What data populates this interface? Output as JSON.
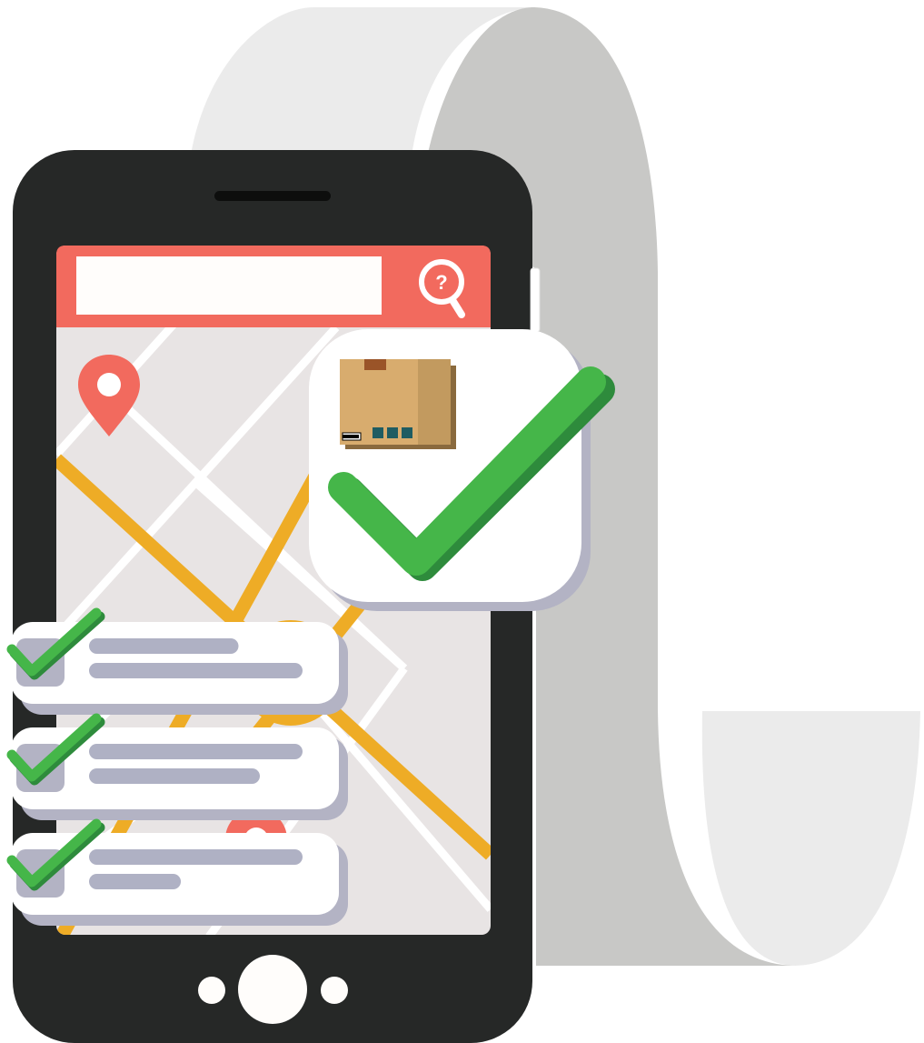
{
  "colors": {
    "background": "#ffffff",
    "scroll_light": "#ebebeb",
    "scroll_dark": "#c8c8c6",
    "phone_body": "#262827",
    "screen_bg": "#e8e4e4",
    "search_bar": "#f26a5e",
    "search_input": "#fffdfb",
    "road_major": "#eeac26",
    "road_minor": "#ffffff",
    "pin": "#f26a5e",
    "card": "#ffffff",
    "card_shadow": "#b3b3c4",
    "check_green": "#45b649",
    "check_dark_green": "#2e8b3c",
    "placeholder_line": "#afb1c4",
    "box_light": "#d8ac6e",
    "box_dark": "#c29a5f",
    "box_tape": "#9a5428",
    "box_label": "#1f5c62"
  },
  "icons": {
    "search": "search-help-icon",
    "location": "location-pin-icon",
    "delivered": "package-box-icon",
    "confirmation": "checkmark-icon"
  },
  "checklist": [
    {
      "checked": true,
      "line_widths": [
        0.7,
        1.0
      ]
    },
    {
      "checked": true,
      "line_widths": [
        1.0,
        0.8
      ]
    },
    {
      "checked": true,
      "line_widths": [
        1.0,
        0.43
      ]
    }
  ]
}
